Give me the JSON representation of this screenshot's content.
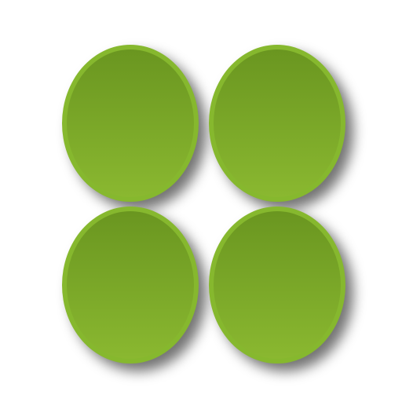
{
  "colors": {
    "rim": "#86b82e",
    "fill_top": "#6a9620",
    "fill_bottom": "#8ab830",
    "background": "#ffffff"
  },
  "tiles": [
    {
      "shape": "oval"
    },
    {
      "shape": "oval"
    },
    {
      "shape": "oval"
    },
    {
      "shape": "oval"
    }
  ]
}
